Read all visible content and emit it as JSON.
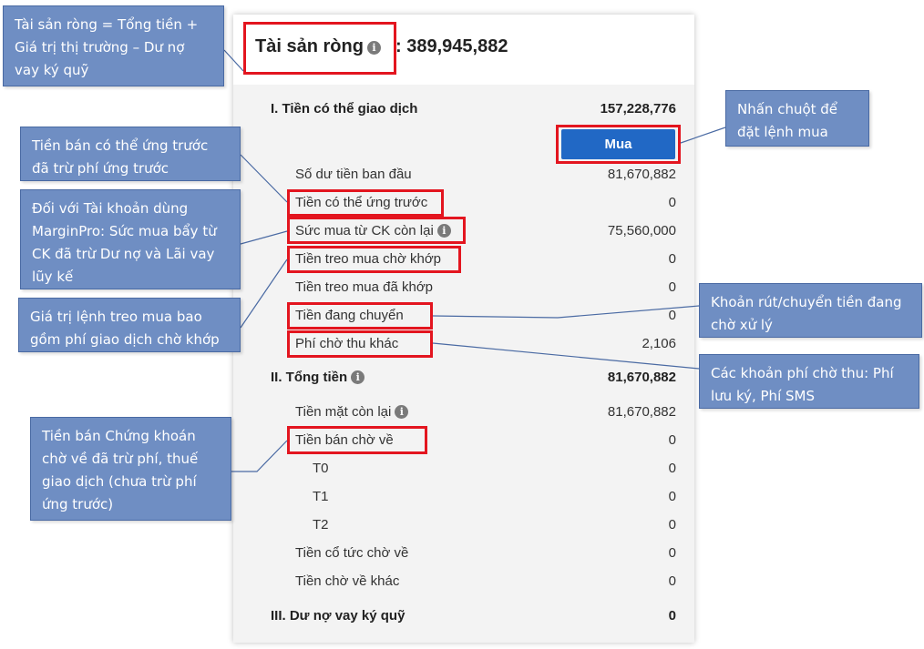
{
  "net_worth": {
    "label": "Tài sản ròng",
    "value": ": 389,945,882"
  },
  "sections": {
    "available": {
      "label": "I. Tiền có thể giao dịch",
      "value": "157,228,776"
    },
    "total": {
      "label": "II. Tổng tiền",
      "value": "81,670,882"
    },
    "margin": {
      "label": "III. Dư nợ vay ký quỹ",
      "value": "0"
    }
  },
  "buy_button": {
    "label": "Mua"
  },
  "rows": {
    "opening_balance": {
      "label": "Số dư tiền ban đầu",
      "value": "81,670,882"
    },
    "advance": {
      "label": "Tiền có thể ứng trước",
      "value": "0"
    },
    "purchasing_power": {
      "label": "Sức mua từ CK còn lại",
      "value": "75,560,000"
    },
    "pending_buy": {
      "label": "Tiền treo mua chờ khớp",
      "value": "0"
    },
    "matched_buy": {
      "label": "Tiền treo mua đã khớp",
      "value": "0"
    },
    "transferring": {
      "label": "Tiền đang chuyển",
      "value": "0"
    },
    "other_fees": {
      "label": "Phí chờ thu khác",
      "value": "2,106"
    },
    "cash_remaining": {
      "label": "Tiền mặt còn lại",
      "value": "81,670,882"
    },
    "sale_pending": {
      "label": "Tiền bán chờ về",
      "value": "0"
    },
    "t0": {
      "label": "T0",
      "value": "0"
    },
    "t1": {
      "label": "T1",
      "value": "0"
    },
    "t2": {
      "label": "T2",
      "value": "0"
    },
    "dividend": {
      "label": "Tiền cổ tức chờ về",
      "value": "0"
    },
    "other_pending": {
      "label": "Tiền chờ về khác",
      "value": "0"
    }
  },
  "callouts": {
    "net_worth": "Tài sản ròng = Tổng tiền + Giá trị thị trường – Dư nợ vay ký quỹ",
    "advance": "Tiền bán có thể ứng trước đã trừ phí ứng trước",
    "margin_pro": "Đối với Tài khoản dùng MarginPro: Sức mua bẩy từ CK đã trừ Dư nợ và Lãi vay lũy kế",
    "pending_buy": "Giá trị lệnh treo mua bao gồm phí giao dịch chờ khớp",
    "sale_pending": "Tiền bán Chứng khoán chờ về đã trừ phí, thuế giao dịch (chưa trừ phí ứng trước)",
    "buy": "Nhấn chuột để đặt lệnh mua",
    "transferring": "Khoản rút/chuyển tiền đang chờ xử lý",
    "fees": "Các khoản phí chờ thu: Phí lưu ký, Phí SMS"
  },
  "icons": {
    "info": "info-icon"
  },
  "colors": {
    "highlight": "#e3151f",
    "button": "#2168c5",
    "callout": "#6f8ec3"
  }
}
